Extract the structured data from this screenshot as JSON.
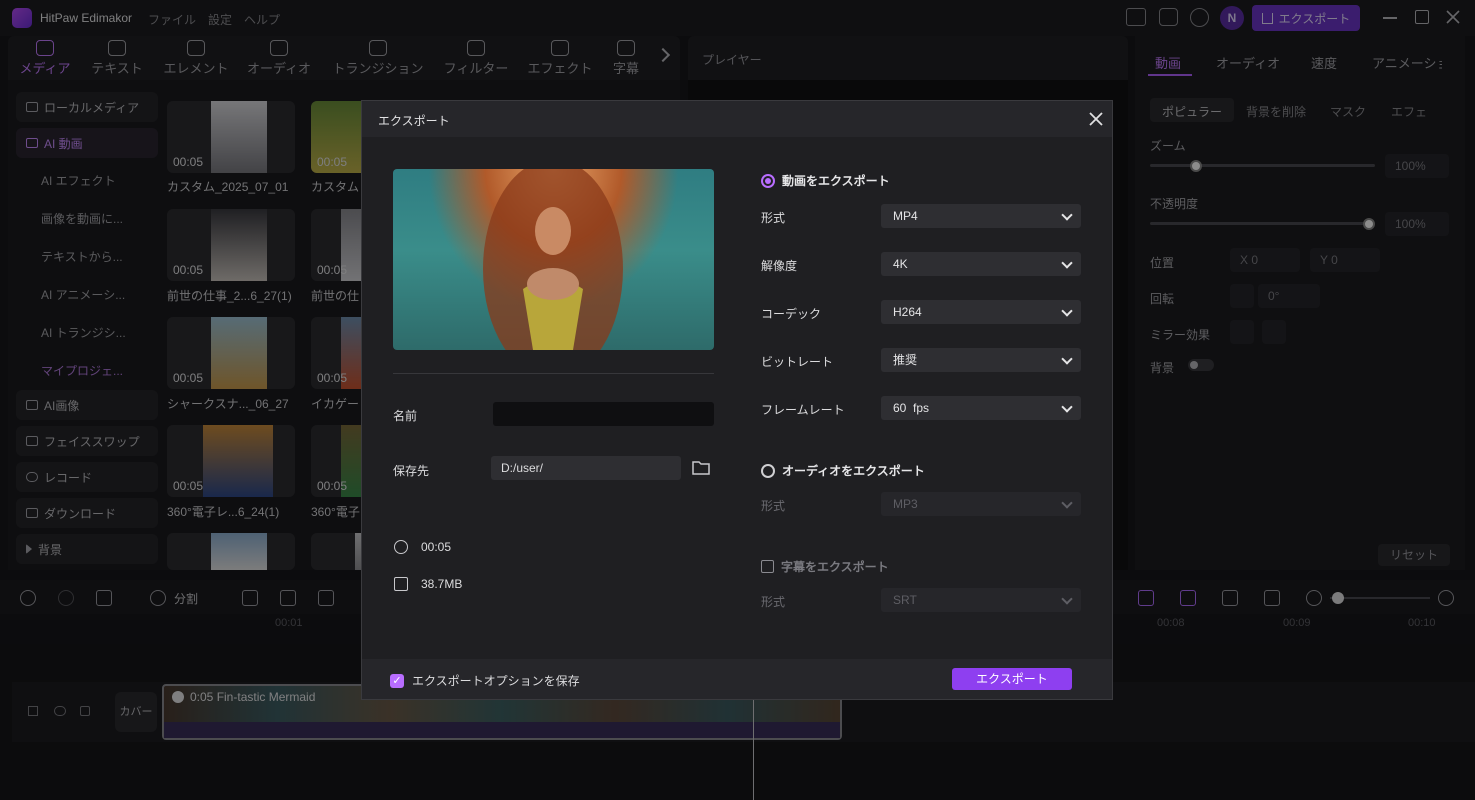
{
  "app": {
    "name": "HitPaw Edimakor",
    "menus": [
      "ファイル",
      "設定",
      "ヘルプ"
    ],
    "avatar_initial": "N",
    "export_label": "エクスポート"
  },
  "media_tabs": [
    "メディア",
    "テキスト",
    "エレメント",
    "オーディオ",
    "トランジション",
    "フィルター",
    "エフェクト",
    "字幕"
  ],
  "sidebar": {
    "items": [
      "ローカルメディア",
      "AI 動画",
      "AI画像",
      "フェイススワップ",
      "レコード",
      "ダウンロード",
      "背景"
    ],
    "ai_sub": [
      "AI エフェクト",
      "画像を動画に...",
      "テキストから...",
      "AI アニメーシ...",
      "AI トランジシ...",
      "マイプロジェ..."
    ]
  },
  "media": [
    {
      "dur": "00:05",
      "label": "カスタム_2025_07_01"
    },
    {
      "dur": "00:05",
      "label": "カスタム"
    },
    {
      "dur": "00:05",
      "label": "前世の仕事_2...6_27(1)"
    },
    {
      "dur": "00:05",
      "label": "前世の仕"
    },
    {
      "dur": "00:05",
      "label": "シャークスナ..._06_27"
    },
    {
      "dur": "00:05",
      "label": "イカゲー"
    },
    {
      "dur": "00:05",
      "label": "360°電子レ...6_24(1)"
    },
    {
      "dur": "00:05",
      "label": "360°電子"
    }
  ],
  "player": {
    "title": "プレイヤー"
  },
  "right_panel": {
    "tabs": [
      "動画",
      "オーディオ",
      "速度",
      "アニメーショ"
    ],
    "subtabs": [
      "ポピュラー",
      "背景を削除",
      "マスク",
      "エフェ"
    ],
    "zoom_label": "ズーム",
    "zoom_value": "100%",
    "zoom_level": 0.0,
    "opacity_label": "不透明度",
    "opacity_value": "100%",
    "opacity_level": 1.0,
    "position_label": "位置",
    "pos_x": "X  0",
    "pos_y": "Y  0",
    "rotation_label": "回転",
    "rotation_value": "0°",
    "mirror_label": "ミラー効果",
    "bg_label": "背景",
    "reset_label": "リセット"
  },
  "timeline": {
    "split_label": "分割",
    "ticks": [
      "00:01",
      "00:08",
      "00:09",
      "00:10"
    ],
    "cover_label": "カバー",
    "clip_label": "0:05 Fin-tastic Mermaid"
  },
  "dialog": {
    "title": "エクスポート",
    "name_label": "名前",
    "save_label": "保存先",
    "save_path": "D:/user/",
    "duration": "00:05",
    "size": "38.7MB",
    "video_export": "動画をエクスポート",
    "format_label": "形式",
    "format_value": "MP4",
    "resolution_label": "解像度",
    "resolution_value": "4K",
    "codec_label": "コーデック",
    "codec_value": "H264",
    "bitrate_label": "ビットレート",
    "bitrate_value": "推奨",
    "framerate_label": "フレームレート",
    "framerate_value": "60  fps",
    "audio_export": "オーディオをエクスポート",
    "audio_format_label": "形式",
    "audio_format_value": "MP3",
    "subtitle_export": "字幕をエクスポート",
    "sub_format_label": "形式",
    "sub_format_value": "SRT",
    "save_options": "エクスポートオプションを保存",
    "export_button": "エクスポート"
  }
}
